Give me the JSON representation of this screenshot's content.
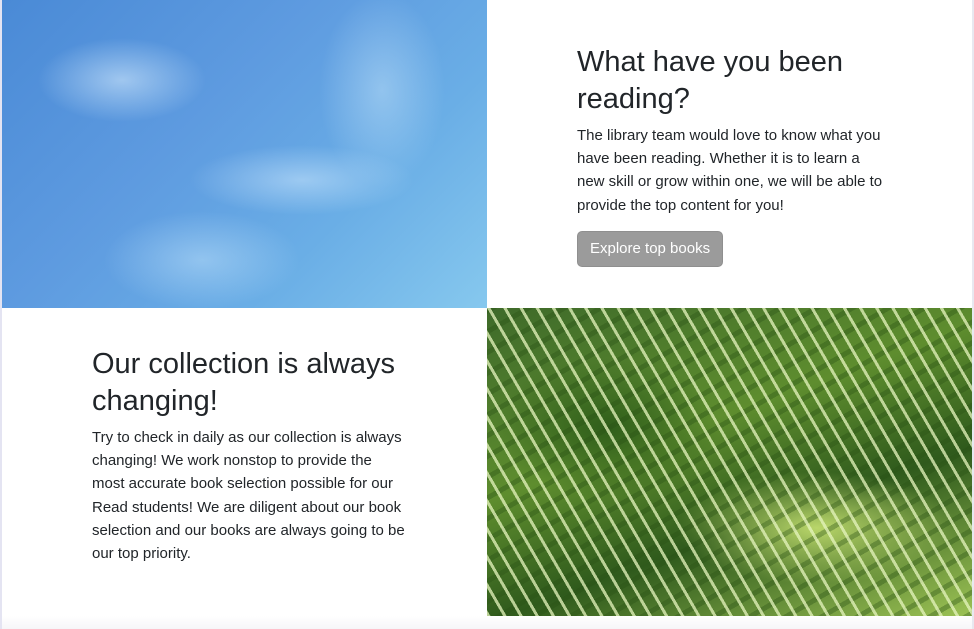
{
  "section_reading": {
    "heading": "What have you been reading?",
    "body": "The library team would love to know what you have been reading. Whether it is to learn a new skill or grow within one, we will be able to provide the top content for you!",
    "button_label": "Explore top books"
  },
  "section_collection": {
    "heading": "Our collection is always changing!",
    "body": "Try to check in daily as our collection is always changing! We work nonstop to provide the most accurate book selection possible for our Read students! We are diligent about our book selection and our books are always going to be our top priority."
  }
}
